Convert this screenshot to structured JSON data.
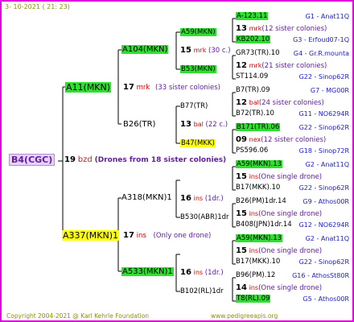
{
  "header": {
    "date": "3- 10-2021 ( 21: 23)"
  },
  "root": {
    "id": "B4(CGC)",
    "gen": "19",
    "mark": "bzd",
    "note": "(Drones from 18 sister colonies)"
  },
  "gen1": [
    {
      "id": "A11(MKN)",
      "gen": "17",
      "mark": "mrk",
      "note": "(33 sister colonies)"
    },
    {
      "id": "A337(MKN)1",
      "gen": "17",
      "mark": "ins",
      "note": "(Only one drone)"
    }
  ],
  "gen2": [
    {
      "id": "A104(MKN)",
      "gen": "15",
      "mark": "mrk",
      "note": "(30 c.)"
    },
    {
      "id": "B26(TR)"
    },
    {
      "id": "A318(MKN)1",
      "gen": "16",
      "mark": "ins",
      "note": "(1dr.)"
    },
    {
      "id": "A533(MKN)1",
      "gen": "16",
      "mark": "ins",
      "note": "(1dr.)"
    }
  ],
  "gen3": [
    {
      "id": "A59(MKN)"
    },
    {
      "id": "B53(MKN)"
    },
    {
      "id": "B77(TR)",
      "gen": "13",
      "mark": "bal",
      "note": "(22 c.)"
    },
    {
      "id": "B47(MKK)"
    },
    {
      "id": "B530(ABR)1dr"
    },
    {
      "id": "B102(RL)1dr"
    }
  ],
  "gen4": [
    {
      "id": "A-123.11",
      "code": "G1 - Anat11Q"
    },
    {
      "gen": "13",
      "mark": "mrk",
      "note": "(12 sister colonies)"
    },
    {
      "id": "KB202.10",
      "code": "G3 - Erfoud07-1Q"
    },
    {
      "id": "GR73(TR).10",
      "code": "G4 - Gr.R.mounta"
    },
    {
      "gen": "12",
      "mark": "mrk",
      "note": "(21 sister colonies)"
    },
    {
      "id": "ST114.09",
      "code": "G22 - Sinop62R"
    },
    {
      "id": "B7(TR).09",
      "code": "G7 - MG00R"
    },
    {
      "gen": "12",
      "mark": "bal",
      "note": "(24 sister colonies)"
    },
    {
      "id": "B72(TR).10",
      "code": "G11 - NO6294R"
    },
    {
      "id": "B171(TR).06",
      "code": "G22 - Sinop62R"
    },
    {
      "gen": "09",
      "mark": "nex",
      "note": "(12 sister colonies)"
    },
    {
      "id": "PS596.06",
      "code": "G18 - Sinop72R"
    },
    {
      "id": "A59(MKN).13",
      "code": "G2 - Anat11Q"
    },
    {
      "gen": "15",
      "mark": "ins",
      "note": "(One single drone)"
    },
    {
      "id": "B17(MKK).10",
      "code": "G22 - Sinop62R"
    },
    {
      "id": "B26(PM)1dr.14",
      "code": "G9 - Athos00R"
    },
    {
      "gen": "15",
      "mark": "ins",
      "note": "(One single drone)"
    },
    {
      "id": "B408(JPN)1dr.14",
      "code": "G12 - NO6294R"
    },
    {
      "id": "A59(MKN).13",
      "code": "G2 - Anat11Q"
    },
    {
      "gen": "15",
      "mark": "ins",
      "note": "(One single drone)"
    },
    {
      "id": "B17(MKK).10",
      "code": "G22 - Sinop62R"
    },
    {
      "id": "B96(PM).12",
      "code": "G16 - AthosSt80R"
    },
    {
      "gen": "14",
      "mark": "ins",
      "note": "(One single drone)"
    },
    {
      "id": "T8(RL).09",
      "code": "G5 - Athos00R"
    }
  ],
  "footer": {
    "copyright": "Copyright 2004-2021 @ Karl Kehrle Foundation",
    "url": "www.pedigreeapis.org"
  }
}
